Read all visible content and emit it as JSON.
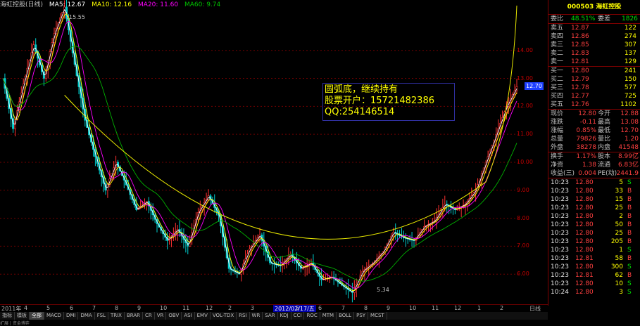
{
  "chart_title": "海虹控股(日线)",
  "ma": [
    {
      "label": "MA5: 12.67",
      "color": "#ffffff"
    },
    {
      "label": "MA10: 12.16",
      "color": "#ffff00"
    },
    {
      "label": "MA20: 11.60",
      "color": "#ff00ff"
    },
    {
      "label": "MA60: 9.74",
      "color": "#00c000"
    }
  ],
  "annotations": {
    "high": "15.55",
    "low": "5.34",
    "current_price_tag": "12.70"
  },
  "overlay_text": {
    "line1": "圆弧底，继续持有",
    "line2": "股票开户：15721482386",
    "line3": "QQ:254146514"
  },
  "price_axis": [
    "14.00",
    "13.00",
    "12.00",
    "11.00",
    "10.00",
    "9.00",
    "8.00",
    "7.00",
    "6.00"
  ],
  "months": [
    "2011年",
    "4",
    "5",
    "6",
    "7",
    "8",
    "9",
    "10",
    "11",
    "12",
    "2",
    "3",
    "2012/02/17/五",
    "5",
    "6",
    "7",
    "8",
    "9",
    "10",
    "11",
    "12",
    "1",
    "2",
    "日线"
  ],
  "tabs": [
    "指标",
    "模板",
    "全部",
    "MACD",
    "DMI",
    "DMA",
    "FSL",
    "TRIX",
    "BRAR",
    "CR",
    "VR",
    "OBV",
    "ASI",
    "EMV",
    "VOL-TDX",
    "RSI",
    "WR",
    "SAR",
    "KDJ",
    "CCI",
    "ROC",
    "MTM",
    "BOLL",
    "PSY",
    "MCST"
  ],
  "bottom_text": "扩展 | 资金博弈",
  "quote": {
    "title": "000503 海虹控股",
    "weibi": {
      "label": "委比",
      "value": "48.51%",
      "label2": "委差",
      "value2": "1826"
    },
    "sells": [
      {
        "label": "卖五",
        "price": "12.87",
        "vol": "122"
      },
      {
        "label": "卖四",
        "price": "12.86",
        "vol": "274"
      },
      {
        "label": "卖三",
        "price": "12.85",
        "vol": "307"
      },
      {
        "label": "卖二",
        "price": "12.83",
        "vol": "137"
      },
      {
        "label": "卖一",
        "price": "12.81",
        "vol": "129"
      }
    ],
    "buys": [
      {
        "label": "买一",
        "price": "12.80",
        "vol": "241"
      },
      {
        "label": "买二",
        "price": "12.79",
        "vol": "150"
      },
      {
        "label": "买三",
        "price": "12.78",
        "vol": "577"
      },
      {
        "label": "买四",
        "price": "12.77",
        "vol": "725"
      },
      {
        "label": "买五",
        "price": "12.76",
        "vol": "1102"
      }
    ],
    "stats": [
      {
        "l1": "现价",
        "v1": "12.80",
        "l2": "今开",
        "v2": "12.88"
      },
      {
        "l1": "涨跌",
        "v1": "-0.11",
        "l2": "最高",
        "v2": "13.08"
      },
      {
        "l1": "涨幅",
        "v1": "0.85%",
        "l2": "最低",
        "v2": "12.70"
      },
      {
        "l1": "总量",
        "v1": "79826",
        "l2": "量比",
        "v2": "1.20"
      },
      {
        "l1": "外盘",
        "v1": "38278",
        "l2": "内盘",
        "v2": "41548"
      }
    ],
    "stats2": [
      {
        "l1": "换手",
        "v1": "1.17%",
        "l2": "股本",
        "v2": "8.99亿"
      },
      {
        "l1": "净资",
        "v1": "1.38",
        "l2": "流通",
        "v2": "6.83亿"
      },
      {
        "l1": "收益(三)",
        "v1": "0.004",
        "l2": "PE(动)",
        "v2": "2441.9"
      }
    ],
    "ticks": [
      {
        "t": "10:23",
        "p": "12.80",
        "v": "5",
        "s": "S"
      },
      {
        "t": "10:23",
        "p": "12.80",
        "v": "33",
        "s": "B"
      },
      {
        "t": "10:23",
        "p": "12.80",
        "v": "15",
        "s": "B"
      },
      {
        "t": "10:23",
        "p": "12.80",
        "v": "25",
        "s": "B"
      },
      {
        "t": "10:23",
        "p": "12.80",
        "v": "2",
        "s": "B"
      },
      {
        "t": "10:23",
        "p": "12.80",
        "v": "50",
        "s": "B"
      },
      {
        "t": "10:23",
        "p": "12.80",
        "v": "25",
        "s": "B"
      },
      {
        "t": "10:23",
        "p": "12.80",
        "v": "205",
        "s": "B"
      },
      {
        "t": "10:23",
        "p": "12.80",
        "v": "1",
        "s": "S"
      },
      {
        "t": "10:23",
        "p": "12.81",
        "v": "58",
        "s": "B"
      },
      {
        "t": "10:23",
        "p": "12.80",
        "v": "300",
        "s": "S"
      },
      {
        "t": "10:23",
        "p": "12.81",
        "v": "62",
        "s": "B"
      },
      {
        "t": "10:23",
        "p": "12.80",
        "v": "10",
        "s": "S"
      },
      {
        "t": "10:24",
        "p": "12.80",
        "v": "3",
        "s": "S"
      }
    ]
  },
  "chart_data": {
    "type": "line",
    "ylim": [
      5.0,
      15.6
    ],
    "price_path": [
      [
        0,
        13.0
      ],
      [
        0.02,
        11.2
      ],
      [
        0.04,
        12.8
      ],
      [
        0.06,
        14.2
      ],
      [
        0.08,
        13.0
      ],
      [
        0.1,
        14.6
      ],
      [
        0.12,
        15.55
      ],
      [
        0.14,
        13.5
      ],
      [
        0.16,
        11.5
      ],
      [
        0.18,
        10.2
      ],
      [
        0.2,
        9.0
      ],
      [
        0.22,
        10.0
      ],
      [
        0.24,
        9.2
      ],
      [
        0.26,
        8.3
      ],
      [
        0.28,
        8.6
      ],
      [
        0.3,
        7.8
      ],
      [
        0.32,
        7.2
      ],
      [
        0.34,
        7.6
      ],
      [
        0.36,
        7.0
      ],
      [
        0.38,
        8.2
      ],
      [
        0.4,
        8.8
      ],
      [
        0.42,
        8.1
      ],
      [
        0.44,
        6.2
      ],
      [
        0.46,
        6.0
      ],
      [
        0.48,
        6.9
      ],
      [
        0.5,
        7.4
      ],
      [
        0.52,
        6.4
      ],
      [
        0.54,
        6.3
      ],
      [
        0.56,
        6.7
      ],
      [
        0.58,
        6.2
      ],
      [
        0.6,
        6.4
      ],
      [
        0.62,
        5.8
      ],
      [
        0.64,
        5.9
      ],
      [
        0.66,
        5.6
      ],
      [
        0.68,
        5.34
      ],
      [
        0.7,
        6.1
      ],
      [
        0.72,
        6.4
      ],
      [
        0.74,
        6.8
      ],
      [
        0.76,
        7.5
      ],
      [
        0.78,
        7.3
      ],
      [
        0.8,
        7.2
      ],
      [
        0.82,
        7.7
      ],
      [
        0.84,
        7.9
      ],
      [
        0.86,
        8.5
      ],
      [
        0.88,
        8.3
      ],
      [
        0.9,
        8.5
      ],
      [
        0.92,
        9.0
      ],
      [
        0.94,
        10.0
      ],
      [
        0.96,
        11.0
      ],
      [
        0.98,
        12.0
      ],
      [
        1.0,
        12.7
      ]
    ]
  }
}
